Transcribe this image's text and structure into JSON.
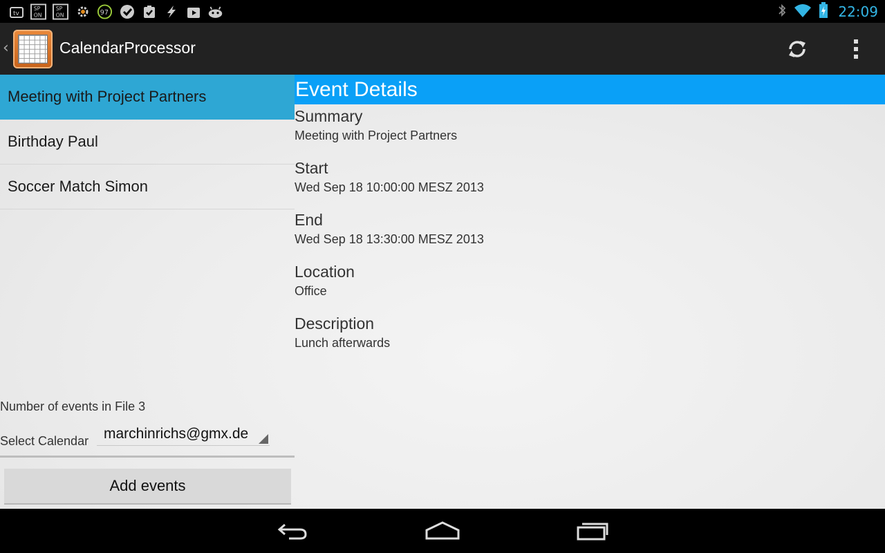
{
  "status_bar": {
    "time": "22:09",
    "notification_icons": [
      "tv-icon",
      "sp-on-icon",
      "sp-on-icon",
      "gear-icon",
      "badge-97-icon",
      "check-icon",
      "clipboard-check-icon",
      "lightning-icon",
      "play-store-icon",
      "android-icon"
    ],
    "badge_number": "97",
    "sp_text_top": "SP",
    "sp_text_bottom": "ON",
    "accent_color": "#33b5e5"
  },
  "action_bar": {
    "title": "CalendarProcessor",
    "icons": [
      "app-calendar-icon",
      "refresh-icon",
      "overflow-menu-icon"
    ]
  },
  "event_list": {
    "items": [
      {
        "label": "Meeting with Project Partners",
        "selected": true
      },
      {
        "label": "Birthday Paul",
        "selected": false
      },
      {
        "label": "Soccer Match Simon",
        "selected": false
      }
    ],
    "selected_color": "#2ea7d4"
  },
  "footer": {
    "count_label": "Number of events in File 3",
    "select_label": "Select Calendar",
    "calendar_value": "marchinrichs@gmx.de",
    "add_button": "Add events"
  },
  "details": {
    "header": "Event Details",
    "header_color": "#0aa0f7",
    "fields": [
      {
        "label": "Summary",
        "value": "Meeting with Project Partners"
      },
      {
        "label": "Start",
        "value": "Wed Sep 18 10:00:00 MESZ 2013"
      },
      {
        "label": "End",
        "value": "Wed Sep 18 13:30:00 MESZ 2013"
      },
      {
        "label": "Location",
        "value": "Office"
      },
      {
        "label": "Description",
        "value": "Lunch afterwards"
      }
    ]
  },
  "nav_bar": {
    "icons": [
      "back-icon",
      "home-icon",
      "recent-apps-icon"
    ]
  }
}
